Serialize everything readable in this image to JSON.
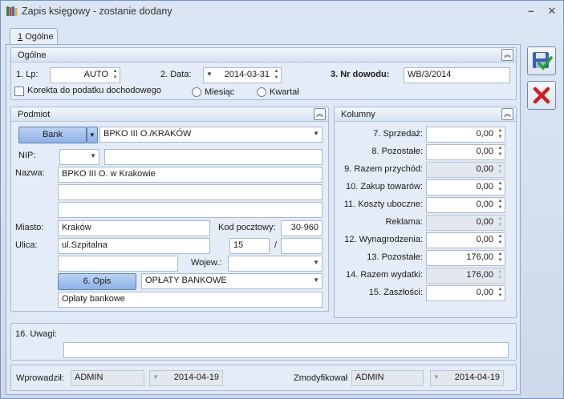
{
  "window": {
    "title": "Zapis księgowy - zostanie dodany"
  },
  "tabs": [
    {
      "key": "1",
      "label": "Ogólne"
    }
  ],
  "general": {
    "header": "Ogólne",
    "lp_label": "1. Lp:",
    "lp_value": "AUTO",
    "date_label": "2. Data:",
    "date_value": "2014-03-31",
    "doc_label": "3. Nr dowodu:",
    "doc_value": "WB/3/2014",
    "correction_label": "Korekta do podatku dochodowego",
    "radio_month": "Miesiąc",
    "radio_quarter": "Kwartał"
  },
  "subject": {
    "header": "Podmiot",
    "type_button": "Bank",
    "selected": "BPKO III O./KRAKÓW",
    "nip_label": "NIP:",
    "nip_prefix": "",
    "nip_value": "",
    "name_label": "Nazwa:",
    "name1": "BPKO III O. w Krakowie",
    "name2": "",
    "name3": "",
    "city_label": "Miasto:",
    "city": "Kraków",
    "postal_label": "Kod pocztowy:",
    "postal": "30-960",
    "street_label": "Ulica:",
    "street": "ul.Szpitalna",
    "house": "15",
    "slash": "/",
    "flat": "",
    "extra_line": "",
    "province_label": "Wojew.:",
    "province": "",
    "desc_button": "6. Opis",
    "desc_select": "OPŁATY BANKOWE",
    "desc_text": "Opłaty bankowe"
  },
  "columns": {
    "header": "Kolumny",
    "rows": [
      {
        "label": "7. Sprzedaż:",
        "value": "0,00",
        "disabled": false
      },
      {
        "label": "8. Pozostałe:",
        "value": "0,00",
        "disabled": false
      },
      {
        "label": "9. Razem przychód:",
        "value": "0,00",
        "disabled": true
      },
      {
        "label": "10. Zakup towarów:",
        "value": "0,00",
        "disabled": false
      },
      {
        "label": "11. Koszty uboczne:",
        "value": "0,00",
        "disabled": false
      },
      {
        "label": "Reklama:",
        "value": "0,00",
        "disabled": true
      },
      {
        "label": "12. Wynagrodzenia:",
        "value": "0,00",
        "disabled": false
      },
      {
        "label": "13. Pozostałe:",
        "value": "176,00",
        "disabled": false
      },
      {
        "label": "14. Razem wydatki:",
        "value": "176,00",
        "disabled": true
      },
      {
        "label": "15. Zaszłości:",
        "value": "0,00",
        "disabled": false
      }
    ]
  },
  "notes": {
    "label": "16. Uwagi:",
    "value": ""
  },
  "footer": {
    "entered_label": "Wprowadził:",
    "entered_by": "ADMIN",
    "entered_date": "2014-04-19",
    "modified_label": "Zmodyfikował",
    "modified_by": "ADMIN",
    "modified_date": "2014-04-19"
  },
  "icons": {
    "app": "books-icon",
    "save": "save-disk-check-icon",
    "cancel": "red-x-icon"
  },
  "colors": {
    "accent": "#8eb2e6",
    "cancel": "#d02020",
    "save_check": "#2aa02a"
  }
}
